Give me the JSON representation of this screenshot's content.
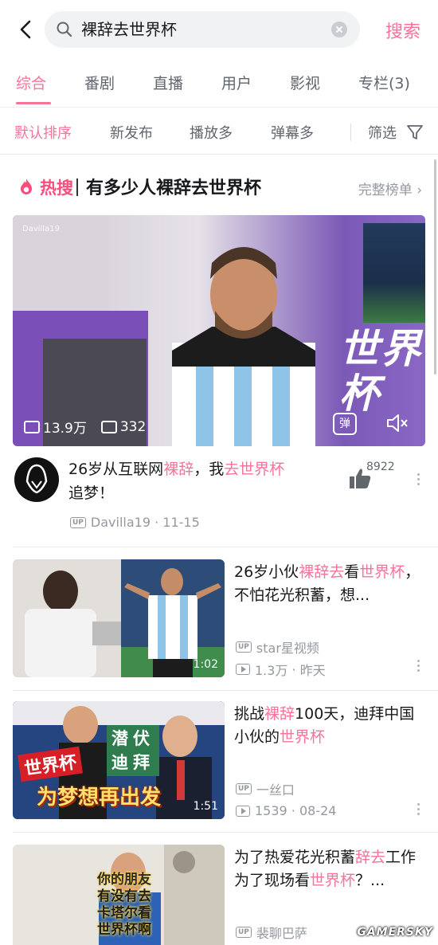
{
  "search": {
    "query": "裸辞去世界杯",
    "button": "搜索"
  },
  "tabs": [
    {
      "label": "综合",
      "active": true
    },
    {
      "label": "番剧"
    },
    {
      "label": "直播"
    },
    {
      "label": "用户"
    },
    {
      "label": "影视"
    },
    {
      "label": "专栏(3)"
    }
  ],
  "sort": {
    "options": [
      "默认排序",
      "新发布",
      "播放多",
      "弹幕多"
    ],
    "filter": "筛选"
  },
  "hot": {
    "badge": "热搜",
    "title": "有多少人裸辞去世界杯",
    "more": "完整榜单"
  },
  "featured": {
    "watermark": "Davilla19",
    "overlay_text": "世界杯",
    "views": "13.9万",
    "danmaku": "332",
    "danmu_button": "弹",
    "title_parts": [
      "26岁从互联网",
      "裸辞",
      "，我",
      "去世界杯",
      "追梦！"
    ],
    "likes": "8922",
    "uploader": "Davilla19",
    "date": "11-15"
  },
  "videos": [
    {
      "title_parts": [
        "26岁小伙",
        "裸辞去",
        "看",
        "世界杯",
        "，不怕花光积蓄，想..."
      ],
      "duration": "1:02",
      "uploader": "star星视频",
      "views": "1.3万",
      "date": "昨天"
    },
    {
      "title_parts": [
        "挑战",
        "裸辞",
        "100天，迪拜中国小伙的",
        "世界杯",
        ""
      ],
      "duration": "1:51",
      "thumb_text": [
        "世界杯",
        "潜伏迪拜",
        "为梦想再出发"
      ],
      "uploader": "一丝口",
      "views": "1539",
      "date": "08-24"
    },
    {
      "title_parts": [
        "为了热爱花光积蓄",
        "辞去",
        "工作为了现场看",
        "世界杯",
        "？..."
      ],
      "thumb_text": [
        "你的朋友",
        "有没有去",
        "卡塔尔看",
        "世界杯啊"
      ],
      "uploader": "裴聊巴萨"
    }
  ],
  "source_watermark": "GAMERSKY",
  "colors": {
    "accent": "#fb7299",
    "hot": "#fb4d7b",
    "meta": "#9499a0"
  }
}
